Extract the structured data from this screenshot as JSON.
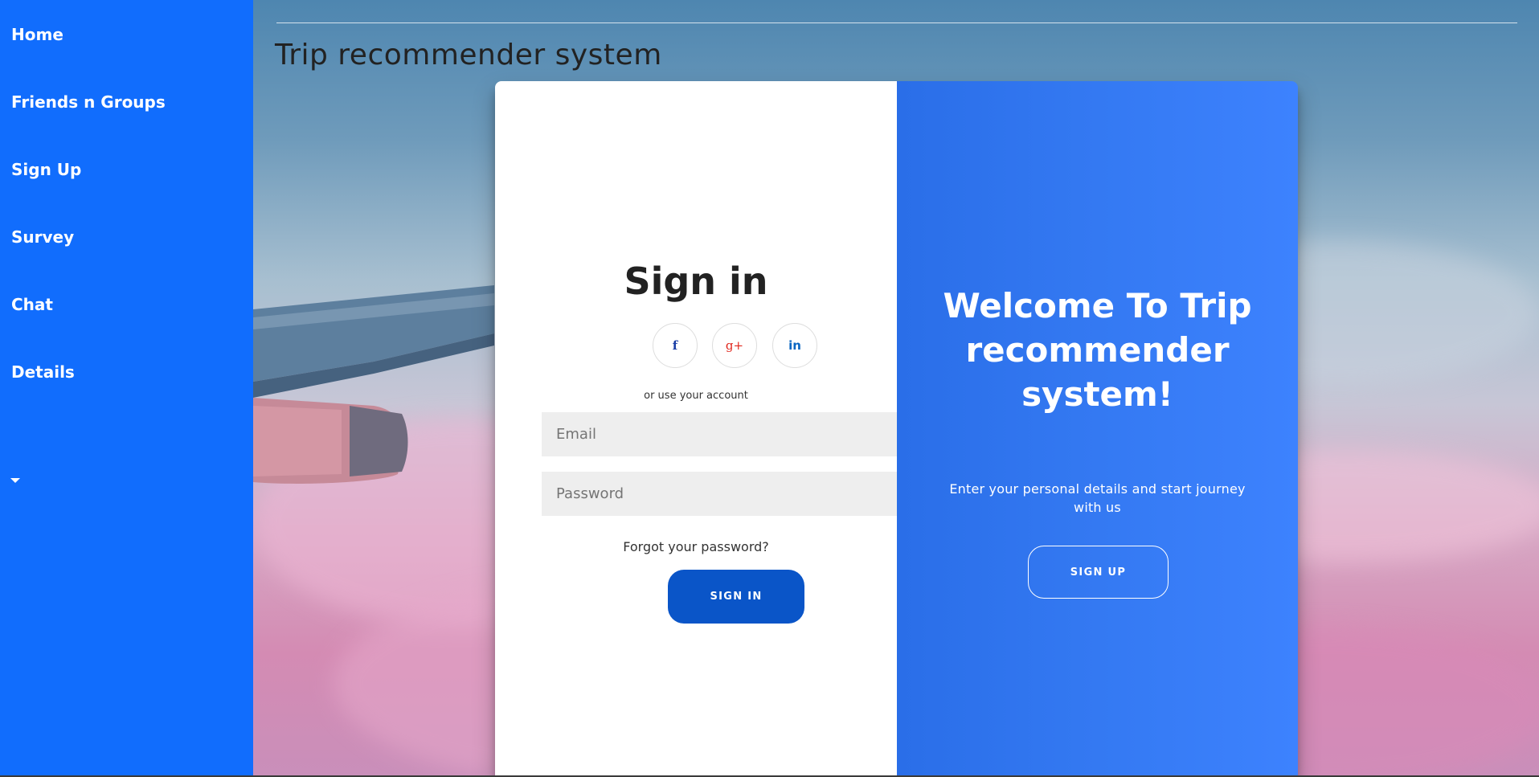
{
  "sidebar": {
    "items": [
      {
        "label": "Home"
      },
      {
        "label": "Friends n Groups"
      },
      {
        "label": "Sign Up"
      },
      {
        "label": "Survey"
      },
      {
        "label": "Chat"
      },
      {
        "label": "Details"
      }
    ],
    "dropdown_icon": "caret-down-icon"
  },
  "header": {
    "title": "Trip recommender system"
  },
  "signin": {
    "title": "Sign in",
    "social": [
      {
        "icon": "facebook-icon",
        "glyph": "f",
        "color": "#1a3ea6"
      },
      {
        "icon": "google-plus-icon",
        "glyph": "g+",
        "color": "#e0261c"
      },
      {
        "icon": "linkedin-icon",
        "glyph": "in",
        "color": "#0a66c2"
      }
    ],
    "or_text": "or use your account",
    "email_placeholder": "Email",
    "password_placeholder": "Password",
    "forgot_text": "Forgot your password?",
    "button_label": "SIGN IN"
  },
  "welcome": {
    "title": "Welcome To Trip recommender system!",
    "subtitle": "Enter your personal details and start journey with us",
    "button_label": "SIGN UP"
  },
  "colors": {
    "sidebar": "#116dfd",
    "signin_button": "#0a55c8",
    "overlay_panel": "#3479f2"
  }
}
